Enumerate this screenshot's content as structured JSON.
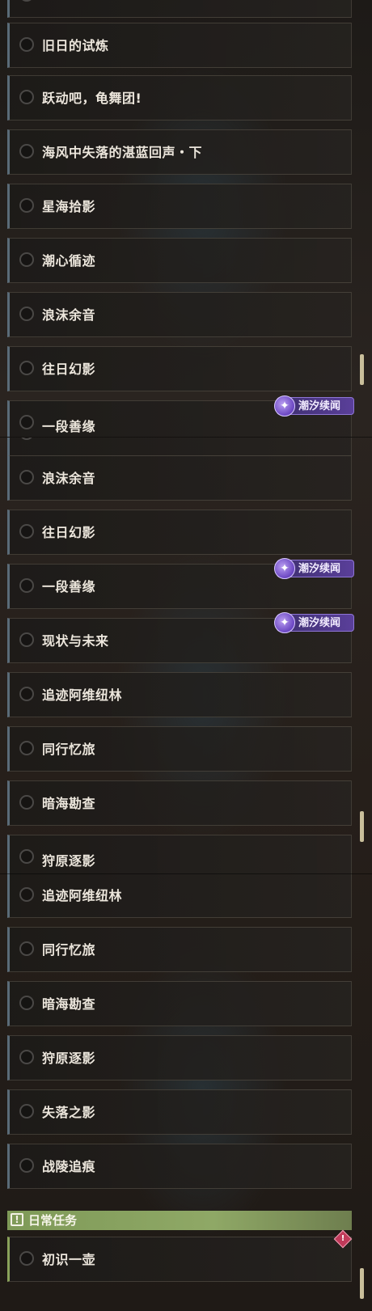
{
  "panel1": {
    "rows": [
      "旧日的试炼",
      "跃动吧，龟舞团!",
      "海风中失落的湛蓝回声・下",
      "星海拾影",
      "潮心循迹",
      "浪沫余音",
      "往日幻影",
      "一段善缘"
    ],
    "badge": "潮汐续闻"
  },
  "panel2": {
    "rows": [
      "浪沫余音",
      "往日幻影",
      "一段善缘",
      "现状与未来",
      "追迹阿维纽林",
      "同行忆旅",
      "暗海勘查",
      "狩原逐影"
    ],
    "badges": [
      "潮汐续闻",
      "潮汐续闻"
    ]
  },
  "panel3": {
    "rows": [
      "追迹阿维纽林",
      "同行忆旅",
      "暗海勘查",
      "狩原逐影",
      "失落之影",
      "战陵追痕"
    ],
    "section_title": "日常任务",
    "daily_rows": [
      "初识一壶"
    ]
  },
  "colors": {
    "accent_daily": "#8aa25a",
    "badge_purple": "#5a3f9a",
    "alert": "#c03a5a"
  }
}
